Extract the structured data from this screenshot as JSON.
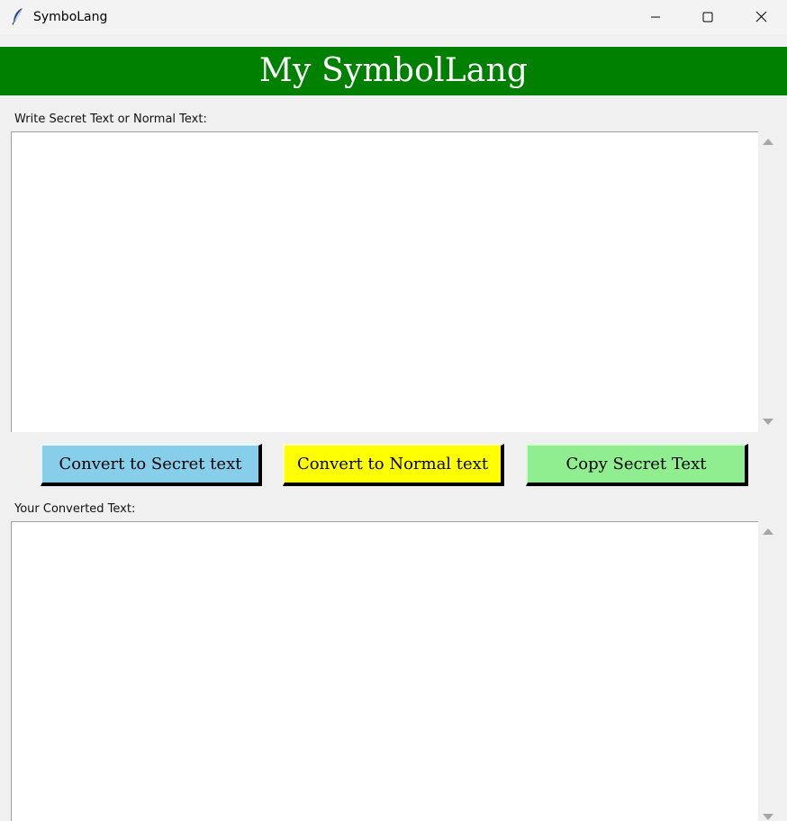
{
  "window": {
    "title": "SymboLang",
    "controls": {
      "minimize_icon": "minimize-icon",
      "maximize_icon": "maximize-icon",
      "close_icon": "close-icon"
    }
  },
  "header": {
    "title": "My SymbolLang",
    "background": "#008000",
    "color": "#ffffff"
  },
  "input_section": {
    "label": "Write Secret Text or Normal Text:",
    "value": ""
  },
  "buttons": {
    "convert_to_secret": {
      "label": "Convert to Secret text",
      "color": "#87ceeb"
    },
    "convert_to_normal": {
      "label": "Convert to Normal text",
      "color": "#ffff00"
    },
    "copy_secret": {
      "label": "Copy Secret Text",
      "color": "#90ee90"
    }
  },
  "output_section": {
    "label": "Your Converted Text:",
    "value": ""
  }
}
